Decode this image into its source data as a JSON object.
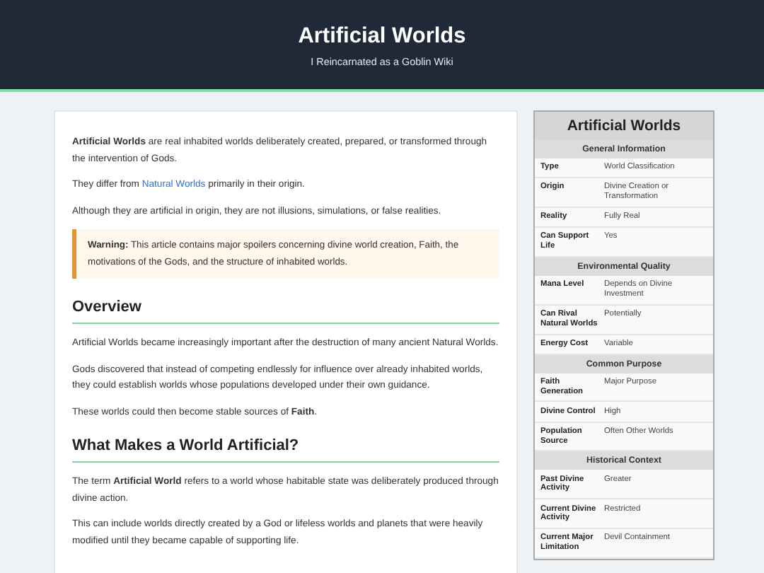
{
  "header": {
    "title": "Artificial Worlds",
    "subtitle": "I Reincarnated as a Goblin Wiki"
  },
  "article": [
    {
      "kind": "paragraph",
      "text": "**Artificial Worlds** are real inhabited worlds deliberately created, prepared, or transformed through the intervention of Gods."
    },
    {
      "kind": "linked",
      "parts": [
        {
          "kind": "text",
          "text": "They differ from "
        },
        {
          "kind": "link",
          "text": "Natural Worlds"
        },
        {
          "kind": "text",
          "text": " primarily in their origin."
        }
      ]
    },
    {
      "kind": "paragraph",
      "text": "Although they are artificial in origin, they are not illusions, simulations, or false realities."
    },
    {
      "kind": "warning",
      "text": "**Warning:** This article contains major spoilers concerning divine world creation, Faith, the motivations of the Gods, and the structure of inhabited worlds."
    },
    {
      "kind": "heading",
      "text": "Overview"
    },
    {
      "kind": "paragraph",
      "text": "Artificial Worlds became increasingly important after the destruction of many ancient Natural Worlds."
    },
    {
      "kind": "paragraph",
      "text": "Gods discovered that instead of competing endlessly for influence over already inhabited worlds, they could establish worlds whose populations developed under their own guidance."
    },
    {
      "kind": "paragraph",
      "text": "These worlds could then become stable sources of **Faith**."
    },
    {
      "kind": "heading",
      "text": "What Makes a World Artificial?"
    },
    {
      "kind": "paragraph",
      "text": "The term **Artificial World** refers to a world whose habitable state was deliberately produced through divine action."
    },
    {
      "kind": "paragraph",
      "text": "This can include worlds directly created by a God or lifeless worlds and planets that were heavily modified until they became capable of supporting life."
    }
  ],
  "infobox": {
    "title": "Artificial Worlds",
    "sections": [
      {
        "title": "General Information",
        "rows": [
          {
            "label": "Type",
            "value": "World Classification"
          },
          {
            "label": "Origin",
            "value": "Divine Creation or Transformation"
          },
          {
            "label": "Reality",
            "value": "Fully Real"
          },
          {
            "label": "Can Support Life",
            "value": "Yes"
          }
        ]
      },
      {
        "title": "Environmental Quality",
        "rows": [
          {
            "label": "Mana Level",
            "value": "Depends on Divine Investment"
          },
          {
            "label": "Can Rival Natural Worlds",
            "value": "Potentially"
          },
          {
            "label": "Energy Cost",
            "value": "Variable"
          }
        ]
      },
      {
        "title": "Common Purpose",
        "rows": [
          {
            "label": "Faith Generation",
            "value": "Major Purpose"
          },
          {
            "label": "Divine Control",
            "value": "High"
          },
          {
            "label": "Population Source",
            "value": "Often Other Worlds"
          }
        ]
      },
      {
        "title": "Historical Context",
        "rows": [
          {
            "label": "Past Divine Activity",
            "value": "Greater"
          },
          {
            "label": "Current Divine Activity",
            "value": "Restricted"
          },
          {
            "label": "Current Major Limitation",
            "value": "Devil Containment"
          }
        ]
      }
    ]
  }
}
